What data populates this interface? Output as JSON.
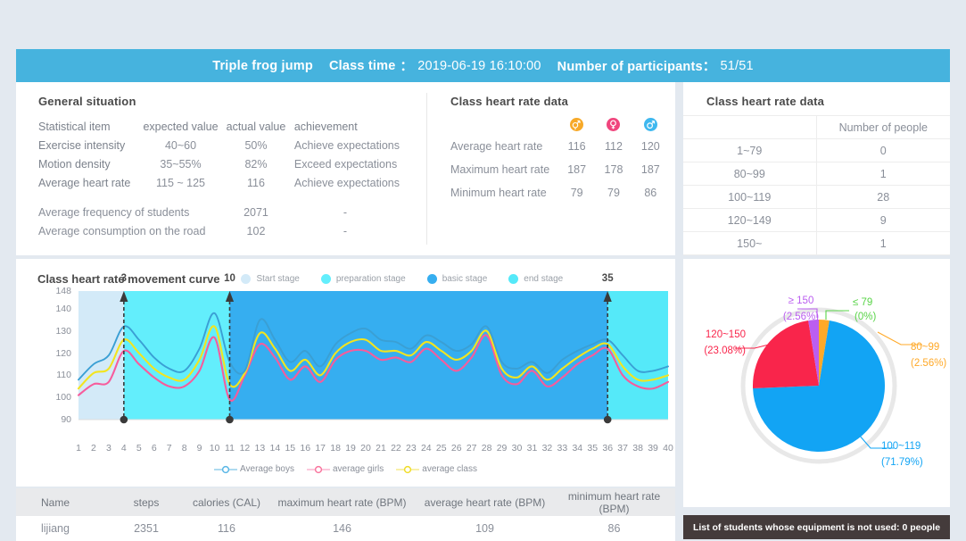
{
  "header": {
    "class_name": "Triple frog jump",
    "class_time_label": "Class time",
    "class_time_sep": "：",
    "class_time_value": "2019-06-19 16:10:00",
    "participants_label": "Number of participants：",
    "participants_value": "51/51"
  },
  "general_situation": {
    "title": "General situation",
    "columns": [
      "Statistical item",
      "expected value",
      "actual value",
      "achievement"
    ],
    "rows": [
      {
        "item": "Exercise intensity",
        "expected": "40~60",
        "actual": "50%",
        "achievement": "Achieve expectations"
      },
      {
        "item": "Motion density",
        "expected": "35~55%",
        "actual": "82%",
        "achievement": "Exceed expectations"
      },
      {
        "item": "Average heart rate",
        "expected": "115 ~ 125",
        "actual": "116",
        "achievement": "Achieve expectations"
      }
    ],
    "extra_rows": [
      {
        "item": "Average frequency of students",
        "actual": "2071",
        "achievement": "-"
      },
      {
        "item": "Average consumption on the road",
        "actual": "102",
        "achievement": "-"
      }
    ]
  },
  "class_heart_rate": {
    "title": "Class heart rate data",
    "icons": [
      {
        "name": "all-gender-icon",
        "color": "#f7a928"
      },
      {
        "name": "female-icon",
        "color": "#f0457d"
      },
      {
        "name": "male-icon",
        "color": "#3fb8ef"
      }
    ],
    "rows": [
      {
        "label": "Average heart rate",
        "values": [
          "116",
          "112",
          "120"
        ]
      },
      {
        "label": "Maximum heart rate",
        "values": [
          "187",
          "178",
          "187"
        ]
      },
      {
        "label": "Minimum heart rate",
        "values": [
          "79",
          "79",
          "86"
        ]
      }
    ]
  },
  "heart_rate_distribution": {
    "title": "Class heart rate data",
    "column_header": "Number of people",
    "rows": [
      {
        "range": "1~79",
        "count": "0"
      },
      {
        "range": "80~99",
        "count": "1"
      },
      {
        "range": "100~119",
        "count": "28"
      },
      {
        "range": "120~149",
        "count": "9"
      },
      {
        "range": "150~",
        "count": "1"
      }
    ]
  },
  "curve_panel": {
    "title": "Class heart rate movement curve",
    "stage_legend": [
      {
        "label": "Start stage",
        "color": "#d3eaf8"
      },
      {
        "label": "preparation stage",
        "color": "#63eefc"
      },
      {
        "label": "basic stage",
        "color": "#36aef0"
      },
      {
        "label": "end stage",
        "color": "#55e9f9"
      }
    ],
    "line_legend": [
      {
        "label": "Average boys",
        "color": "#3a9fd4"
      },
      {
        "label": "average girls",
        "color": "#f75c9c"
      },
      {
        "label": "average class",
        "color": "#f3e41f"
      }
    ]
  },
  "chart_data": {
    "type": "line",
    "title": "Class heart rate movement curve",
    "xlabel": "",
    "ylabel": "",
    "ylim": [
      90,
      148
    ],
    "yticks": [
      90,
      100,
      110,
      120,
      130,
      140,
      148
    ],
    "x": [
      1,
      2,
      3,
      4,
      5,
      6,
      7,
      8,
      9,
      10,
      11,
      12,
      13,
      14,
      15,
      16,
      17,
      18,
      19,
      20,
      21,
      22,
      23,
      24,
      25,
      26,
      27,
      28,
      29,
      30,
      31,
      32,
      33,
      34,
      35,
      36,
      37,
      38,
      39,
      40
    ],
    "xticks": [
      "1",
      "2",
      "3",
      "4",
      "5",
      "6",
      "7",
      "8",
      "9",
      "10",
      "11",
      "12",
      "13",
      "14",
      "15",
      "16",
      "17",
      "18",
      "19",
      "20",
      "21",
      "22",
      "23",
      "24",
      "25",
      "26",
      "27",
      "28",
      "29",
      "30",
      "31",
      "32",
      "33",
      "34",
      "35",
      "36",
      "37",
      "38",
      "39",
      "40"
    ],
    "grid": false,
    "legend_position": "bottom",
    "markers": [
      {
        "label": "3",
        "x": 4
      },
      {
        "label": "10",
        "x": 11
      },
      {
        "label": "35",
        "x": 36
      }
    ],
    "stage_bands": [
      {
        "name": "Start stage",
        "x_start": 1,
        "x_end": 4,
        "color": "#d3eaf8"
      },
      {
        "name": "preparation stage",
        "x_start": 4,
        "x_end": 11,
        "color": "#63eefc"
      },
      {
        "name": "basic stage",
        "x_start": 11,
        "x_end": 36,
        "color": "#36aef0"
      },
      {
        "name": "end stage",
        "x_start": 36,
        "x_end": 40,
        "color": "#55e9f9"
      }
    ],
    "series": [
      {
        "name": "Average boys",
        "color": "#3a9fd4",
        "values": [
          108,
          115,
          119,
          132,
          126,
          118,
          113,
          112,
          122,
          138,
          116,
          112,
          135,
          126,
          116,
          121,
          114,
          124,
          129,
          131,
          126,
          125,
          122,
          128,
          125,
          121,
          124,
          132,
          116,
          113,
          116,
          111,
          117,
          121,
          124,
          126,
          119,
          112,
          112,
          114
        ]
      },
      {
        "name": "average girls",
        "color": "#f75c9c",
        "values": [
          101,
          106,
          107,
          121,
          115,
          109,
          105,
          105,
          112,
          127,
          99,
          110,
          124,
          118,
          108,
          114,
          107,
          117,
          121,
          121,
          117,
          118,
          116,
          122,
          117,
          112,
          118,
          128,
          110,
          106,
          112,
          105,
          109,
          115,
          119,
          122,
          110,
          105,
          104,
          107
        ]
      },
      {
        "name": "average class",
        "color": "#f3e41f",
        "values": [
          104,
          111,
          113,
          126,
          120,
          113,
          109,
          108,
          117,
          132,
          106,
          111,
          129,
          122,
          112,
          117,
          110,
          120,
          125,
          126,
          121,
          121,
          119,
          125,
          121,
          117,
          121,
          130,
          113,
          109,
          114,
          108,
          113,
          118,
          122,
          124,
          114,
          108,
          108,
          110
        ]
      }
    ]
  },
  "pie_chart": {
    "type": "pie",
    "title": "",
    "labels": [
      "≤ 79",
      "80~99",
      "100~119",
      "120~150",
      "≥ 150"
    ],
    "percent_labels": [
      "(0%)",
      "(2.56%)",
      "(71.79%)",
      "(23.08%)",
      "(2.56%)"
    ],
    "values": [
      0,
      2.56,
      71.79,
      23.08,
      2.56
    ],
    "colors": [
      "#5ad449",
      "#ffa928",
      "#12a4f4",
      "#f9254b",
      "#bb5ef0"
    ]
  },
  "student_table": {
    "columns": [
      "Name",
      "steps",
      "calories (CAL)",
      "maximum heart rate (BPM)",
      "average heart rate (BPM)",
      "minimum heart rate (BPM)"
    ],
    "rows": [
      {
        "name": "lijiang",
        "steps": "2351",
        "calories": "116",
        "max_hr": "146",
        "avg_hr": "109",
        "min_hr": "86"
      }
    ]
  },
  "equipment_bar": {
    "text": "List of students whose equipment is not used: 0 people"
  }
}
